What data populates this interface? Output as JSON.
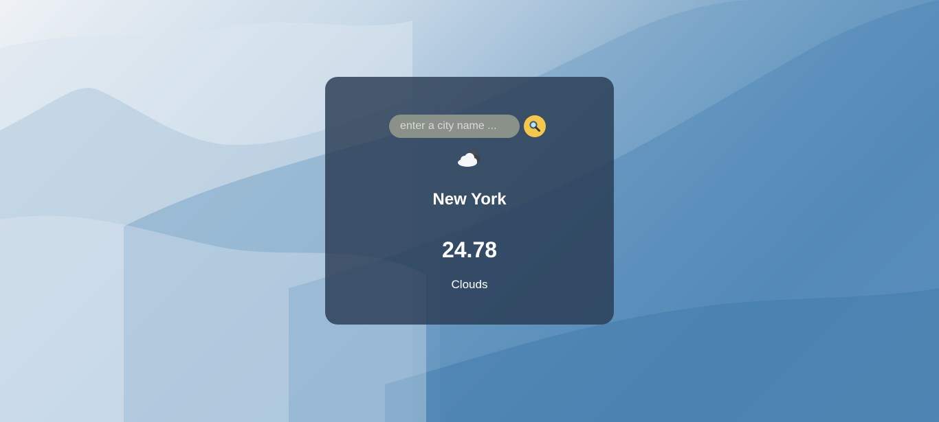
{
  "search": {
    "placeholder": "enter a city name ...",
    "value": "",
    "button_icon": "magnifier-icon"
  },
  "weather": {
    "icon": "cloud-icon",
    "city": "New York",
    "temperature": "24.78",
    "description": "Clouds"
  },
  "colors": {
    "card_background": "#283a52",
    "search_button": "#f5c84c",
    "input_background": "#8a9189",
    "text": "#ffffff"
  }
}
